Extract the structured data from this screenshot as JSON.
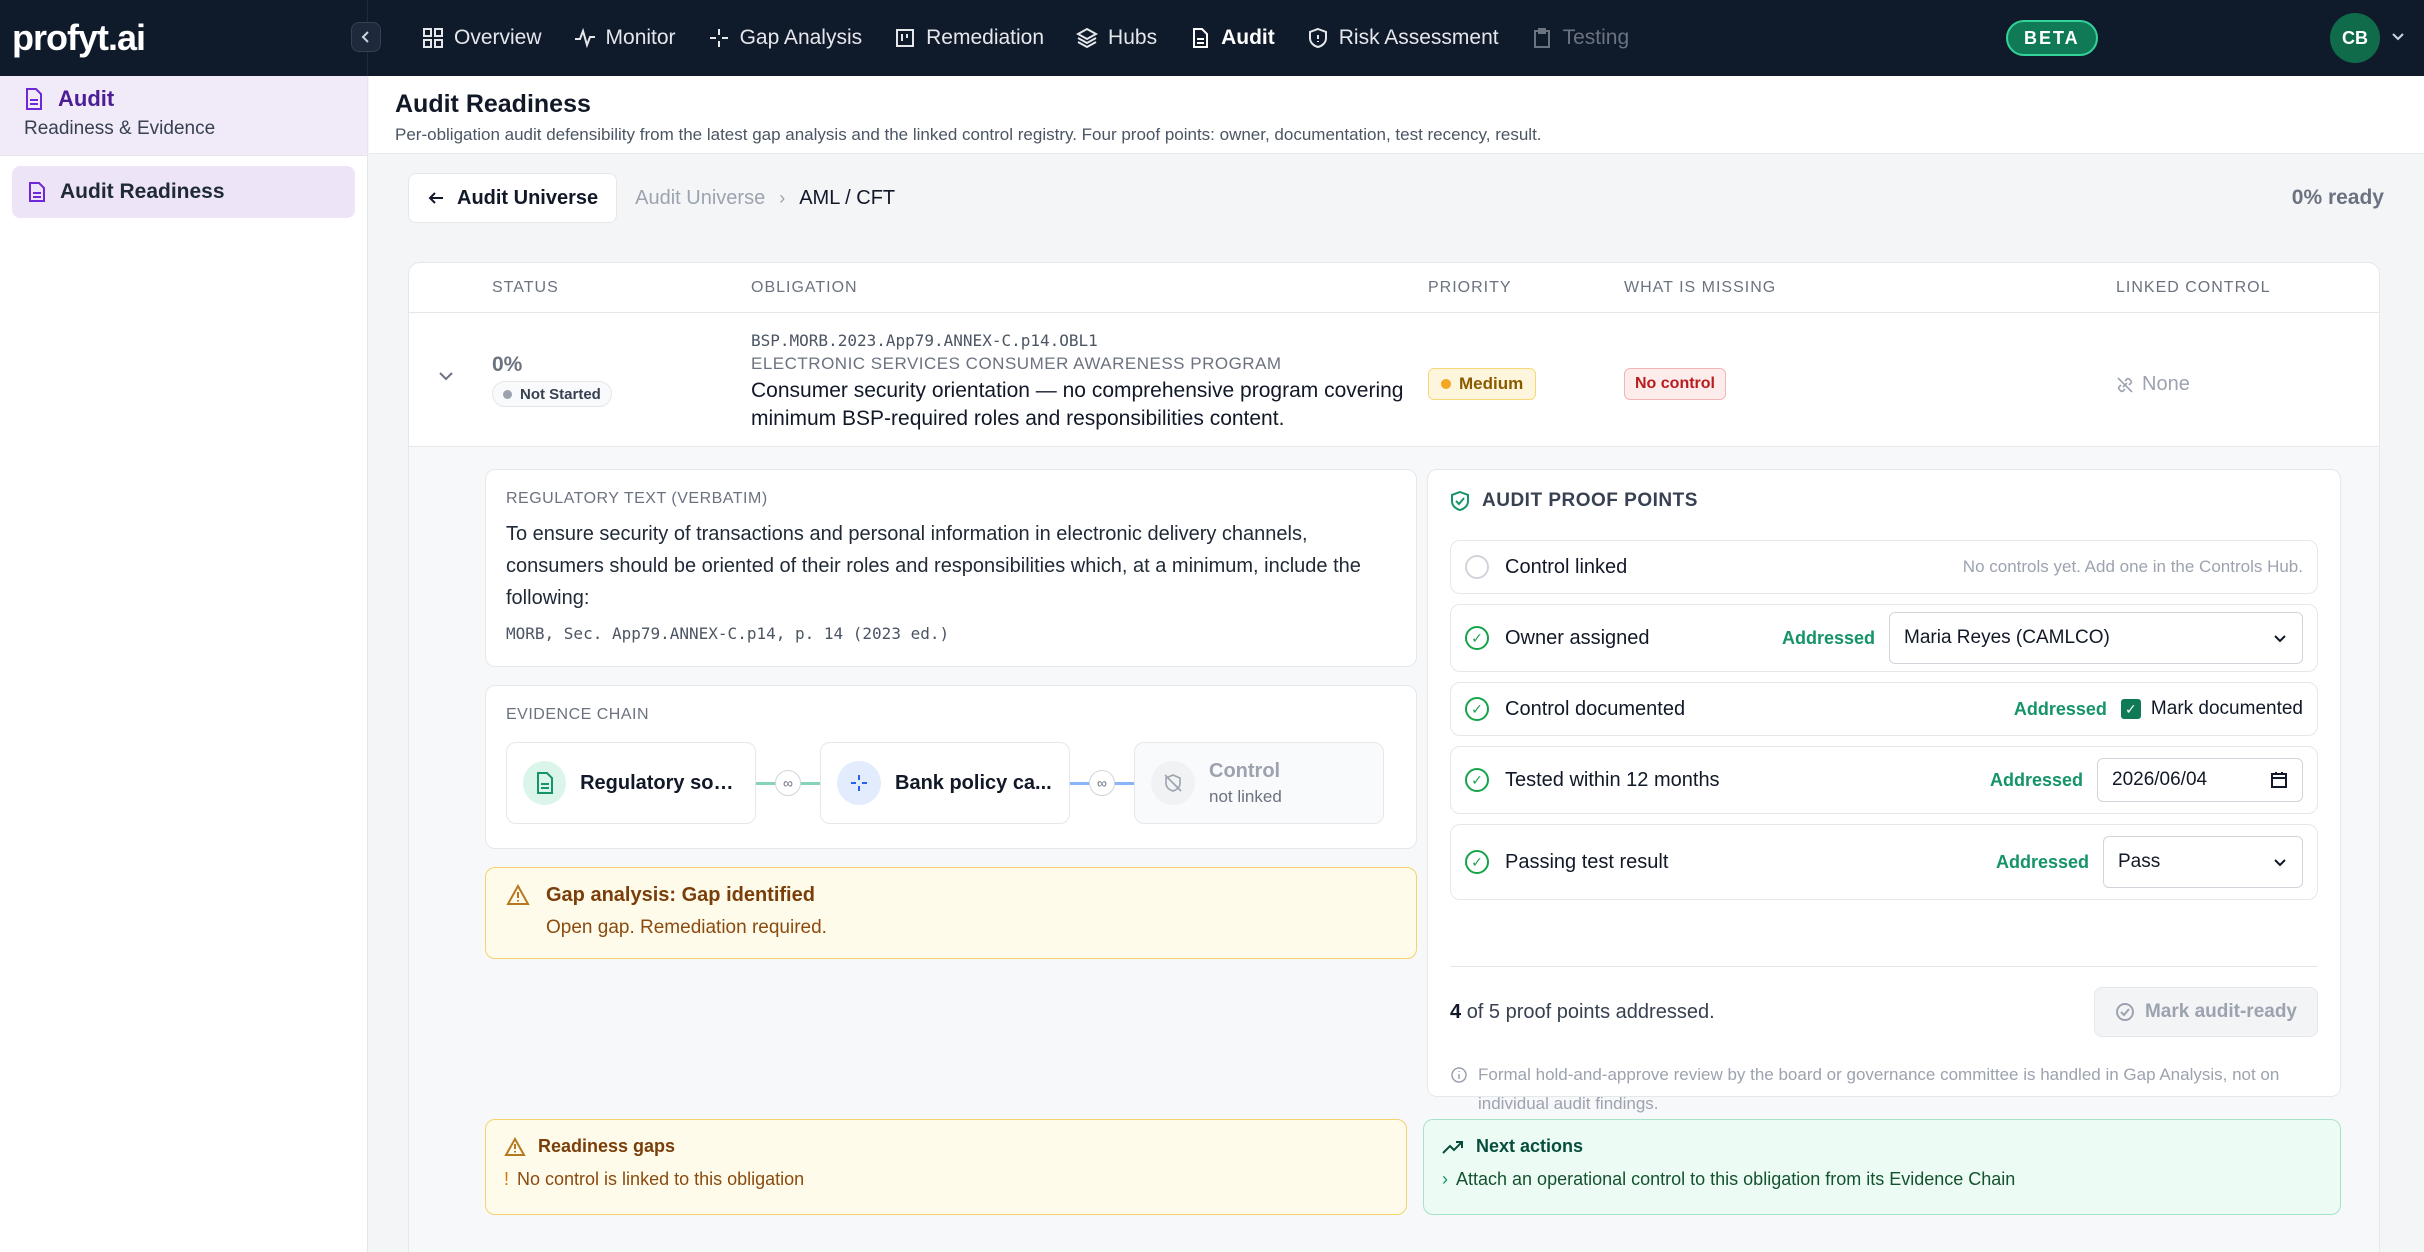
{
  "brand": {
    "name": "profyt.ai"
  },
  "nav": {
    "items": [
      {
        "label": "Overview",
        "icon": "grid-icon"
      },
      {
        "label": "Monitor",
        "icon": "pulse-icon"
      },
      {
        "label": "Gap Analysis",
        "icon": "sparkle-icon"
      },
      {
        "label": "Remediation",
        "icon": "board-icon"
      },
      {
        "label": "Hubs",
        "icon": "layers-icon"
      },
      {
        "label": "Audit",
        "icon": "file-icon",
        "active": true
      },
      {
        "label": "Risk Assessment",
        "icon": "shield-icon"
      },
      {
        "label": "Testing",
        "icon": "clipboard-icon",
        "disabled": true
      }
    ],
    "beta": "BETA",
    "user_initials": "CB"
  },
  "sidebar": {
    "section_title": "Audit",
    "section_sub": "Readiness & Evidence",
    "items": [
      {
        "label": "Audit Readiness",
        "active": true
      }
    ]
  },
  "page": {
    "title": "Audit Readiness",
    "subtitle": "Per-obligation audit defensibility from the latest gap analysis and the linked control registry. Four proof points: owner, documentation, test recency, result."
  },
  "breadcrumb": {
    "back_label": "Audit Universe",
    "parent": "Audit Universe",
    "current": "AML / CFT",
    "ready": "0% ready"
  },
  "table": {
    "headers": {
      "status": "STATUS",
      "obligation": "OBLIGATION",
      "priority": "PRIORITY",
      "missing": "WHAT IS MISSING",
      "linked": "LINKED CONTROL"
    },
    "row": {
      "percent": "0%",
      "status": "Not Started",
      "code": "BSP.MORB.2023.App79.ANNEX-C.p14.OBL1",
      "category": "ELECTRONIC SERVICES CONSUMER AWARENESS PROGRAM",
      "title": "Consumer security orientation — no comprehensive program covering minimum BSP-required roles and responsibilities content.",
      "priority": "Medium",
      "missing": "No control",
      "linked_control": "None"
    }
  },
  "regulatory": {
    "label": "REGULATORY TEXT (VERBATIM)",
    "text": "To ensure security of transactions and personal information in electronic delivery channels, consumers should be oriented of their roles and responsibilities which, at a minimum, include the following:",
    "citation": "MORB, Sec. App79.ANNEX-C.p14, p. 14 (2023 ed.)"
  },
  "evidence": {
    "label": "EVIDENCE CHAIN",
    "nodes": [
      {
        "label": "Regulatory sou..."
      },
      {
        "label": "Bank policy ca..."
      },
      {
        "label": "Control",
        "sub": "not linked"
      }
    ]
  },
  "gap": {
    "title": "Gap analysis: Gap identified",
    "text": "Open gap. Remediation required."
  },
  "proof": {
    "title": "AUDIT PROOF POINTS",
    "rows": [
      {
        "label": "Control linked",
        "addressed": false,
        "note": "No controls yet. Add one in the Controls Hub."
      },
      {
        "label": "Owner assigned",
        "addressed": true,
        "status": "Addressed",
        "value": "Maria Reyes (CAMLCO)"
      },
      {
        "label": "Control documented",
        "addressed": true,
        "status": "Addressed",
        "value": "Mark documented"
      },
      {
        "label": "Tested within 12 months",
        "addressed": true,
        "status": "Addressed",
        "value": "2026/06/04"
      },
      {
        "label": "Passing test result",
        "addressed": true,
        "status": "Addressed",
        "value": "Pass"
      }
    ],
    "count": "4",
    "count_suffix": "of 5 proof points addressed.",
    "button": "Mark audit-ready",
    "note": "Formal hold-and-approve review by the board or governance committee is handled in Gap Analysis, not on individual audit findings."
  },
  "readiness_gaps": {
    "title": "Readiness gaps",
    "item": "No control is linked to this obligation"
  },
  "next_actions": {
    "title": "Next actions",
    "item": "Attach an operational control to this obligation from its Evidence Chain"
  },
  "colors": {
    "accent": "#0f7a55",
    "topbar": "#0f1a2b",
    "warning": "#f5a623",
    "danger": "#b91c1c"
  }
}
